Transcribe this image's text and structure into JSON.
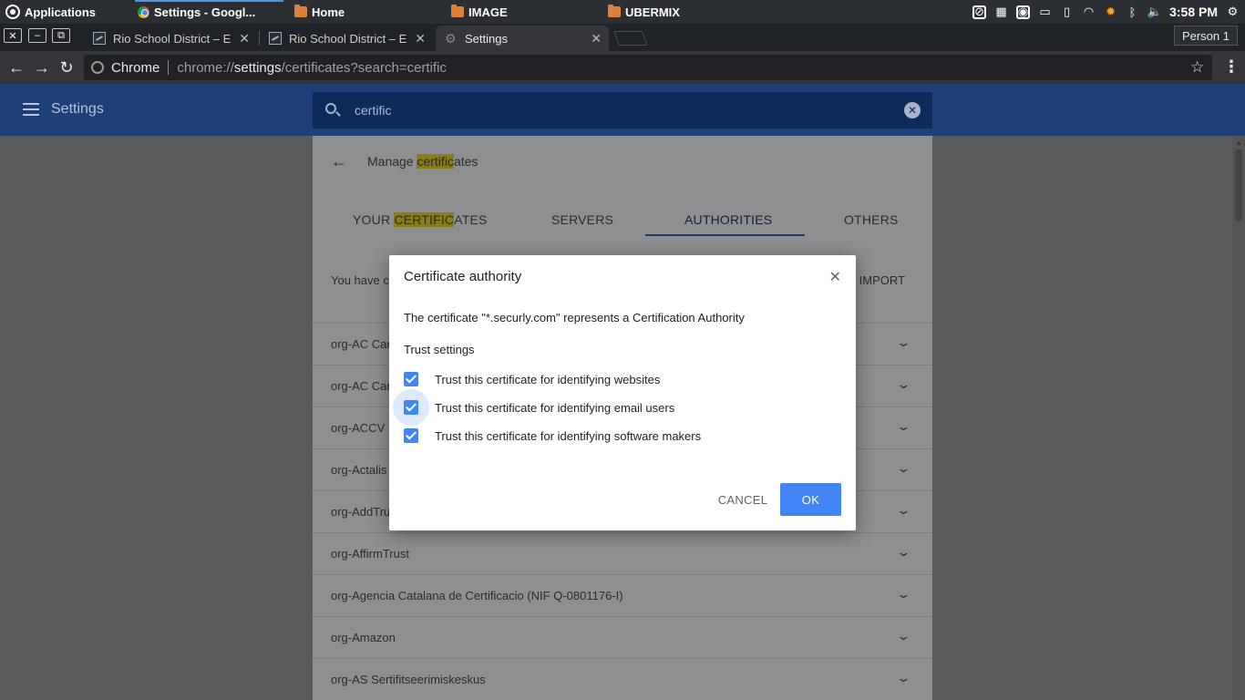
{
  "os_panel": {
    "applications": "Applications",
    "taskbar": [
      {
        "label": "Settings - Googl..."
      },
      {
        "label": "Home"
      },
      {
        "label": "IMAGE"
      },
      {
        "label": "UBERMIX"
      }
    ],
    "clock": "3:58 PM"
  },
  "browser": {
    "tabs": [
      {
        "title": "Rio School District – E"
      },
      {
        "title": "Rio School District – E"
      },
      {
        "title": "Settings"
      }
    ],
    "profile": "Person 1",
    "omnibox": {
      "site": "Chrome",
      "url_scheme": "chrome://",
      "url_host": "settings",
      "url_path": "/certificates?search=certific"
    }
  },
  "settings": {
    "title": "Settings",
    "search_value": "certific",
    "page_title_prefix": "Manage ",
    "page_title_highlight": "certific",
    "page_title_suffix": "ates",
    "tabs": {
      "your_prefix": "YOUR ",
      "your_highlight": "CERTIFIC",
      "your_suffix": "ATES",
      "servers": "SERVERS",
      "authorities": "AUTHORITIES",
      "others": "OTHERS"
    },
    "info_text": "You have c",
    "import_label": "IMPORT",
    "authorities": [
      "org-AC Cam",
      "org-AC Cam",
      "org-ACCV",
      "org-Actalis",
      "org-AddTru",
      "org-AffirmTrust",
      "org-Agencia Catalana de Certificacio (NIF Q-0801176-I)",
      "org-Amazon",
      "org-AS Sertifitseerimiskeskus"
    ]
  },
  "dialog": {
    "title": "Certificate authority",
    "description": "The certificate \"*.securly.com\" represents a Certification Authority",
    "section": "Trust settings",
    "options": [
      {
        "label": "Trust this certificate for identifying websites",
        "checked": true
      },
      {
        "label": "Trust this certificate for identifying email users",
        "checked": true
      },
      {
        "label": "Trust this certificate for identifying software makers",
        "checked": true
      }
    ],
    "cancel": "CANCEL",
    "ok": "OK"
  }
}
